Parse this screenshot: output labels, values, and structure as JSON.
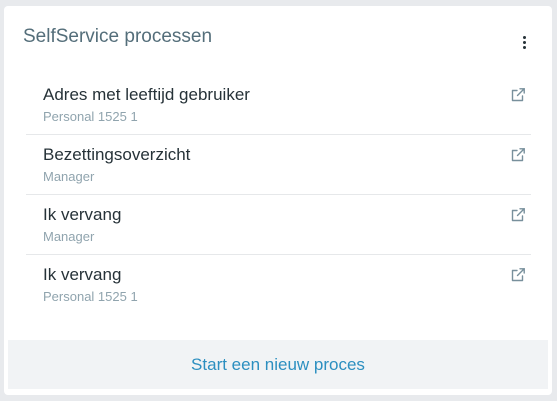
{
  "card": {
    "title": "SelfService processen",
    "menu_icon": "more-vertical-icon"
  },
  "processes": [
    {
      "title": "Adres met leeftijd gebruiker",
      "subtitle": "Personal 1525 1",
      "icon": "external-link-icon"
    },
    {
      "title": "Bezettingsoverzicht",
      "subtitle": "Manager",
      "icon": "external-link-icon"
    },
    {
      "title": "Ik vervang",
      "subtitle": "Manager",
      "icon": "external-link-icon"
    },
    {
      "title": "Ik vervang",
      "subtitle": "Personal 1525 1",
      "icon": "external-link-icon"
    }
  ],
  "footer": {
    "start_label": "Start een nieuw proces"
  },
  "colors": {
    "title": "#546e7a",
    "item_text": "#263238",
    "subtitle_text": "#90a4ae",
    "link": "#2c8fc0",
    "footer_bg": "#f1f3f5",
    "page_bg": "#e8eaed"
  }
}
